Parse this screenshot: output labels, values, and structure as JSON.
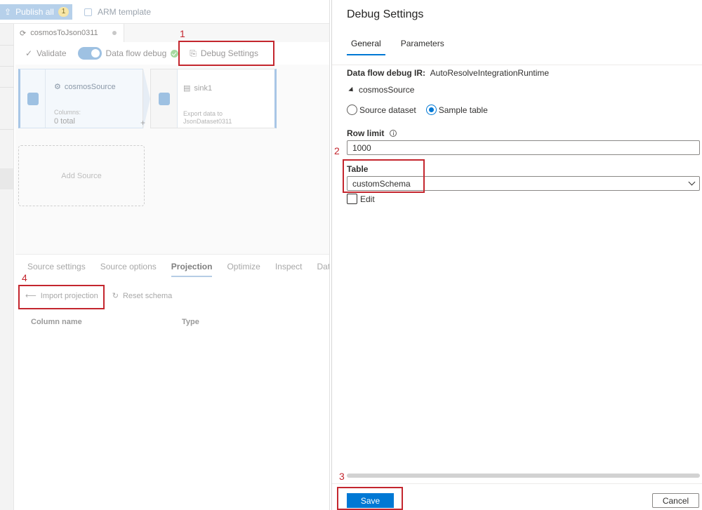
{
  "left": {
    "publish_label": "Publish all",
    "publish_badge": "1",
    "arm_label": "ARM template",
    "doc_tab_title": "cosmosToJson0311",
    "validate_label": "Validate",
    "dataflow_debug_label": "Data flow debug",
    "debug_settings_label": "Debug Settings",
    "source_node": {
      "title": "cosmosSource",
      "columns_label": "Columns:",
      "columns_value": "0 total"
    },
    "sink_node": {
      "title": "sink1",
      "desc_line1": "Export data to",
      "desc_line2": "JsonDataset0311"
    },
    "add_source_label": "Add Source",
    "bottom_tabs": [
      "Source settings",
      "Source options",
      "Projection",
      "Optimize",
      "Inspect",
      "Data"
    ],
    "import_projection_label": "Import projection",
    "reset_schema_label": "Reset schema",
    "col_name_header": "Column name",
    "col_type_header": "Type"
  },
  "panel": {
    "title": "Debug Settings",
    "tabs": [
      "General",
      "Parameters"
    ],
    "ir_label": "Data flow debug IR:",
    "ir_value": "AutoResolveIntegrationRuntime",
    "source_name": "cosmosSource",
    "radio_source_dataset": "Source dataset",
    "radio_sample_table": "Sample table",
    "row_limit_label": "Row limit",
    "row_limit_value": "1000",
    "table_label": "Table",
    "table_value": "customSchema",
    "edit_label": "Edit",
    "save_label": "Save",
    "cancel_label": "Cancel"
  },
  "callouts": [
    "1",
    "2",
    "3",
    "4"
  ],
  "colors": {
    "accent": "#0078d4",
    "callout": "#c4262e"
  }
}
